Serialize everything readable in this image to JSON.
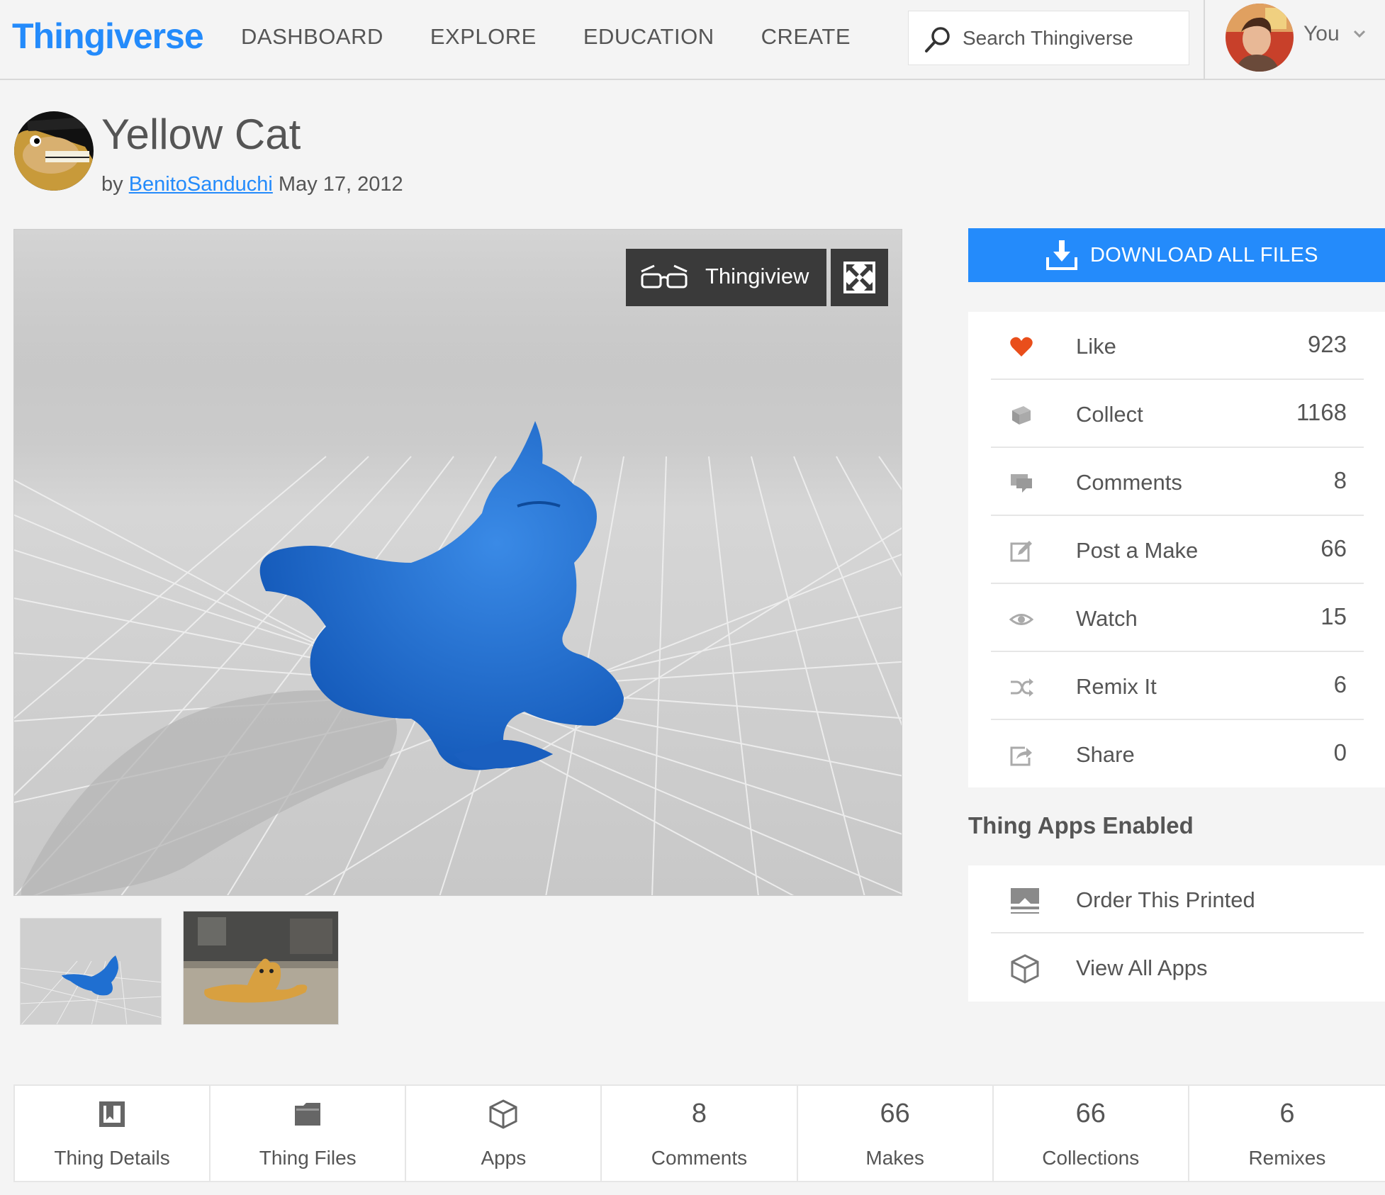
{
  "header": {
    "logo": "Thingiverse",
    "nav": [
      "DASHBOARD",
      "EXPLORE",
      "EDUCATION",
      "CREATE"
    ],
    "search_placeholder": "Search Thingiverse",
    "user_label": "You"
  },
  "thing": {
    "title": "Yellow Cat",
    "by_prefix": "by",
    "author": "BenitoSanduchi",
    "date": "May 17, 2012"
  },
  "viewer": {
    "thingiview_label": "Thingiview",
    "model_color": "#1f6fd1",
    "print_color": "#d8a040"
  },
  "download": {
    "label": "DOWNLOAD ALL FILES"
  },
  "actions": [
    {
      "label": "Like",
      "count": "923",
      "icon": "heart-icon"
    },
    {
      "label": "Collect",
      "count": "1168",
      "icon": "collect-icon"
    },
    {
      "label": "Comments",
      "count": "8",
      "icon": "comment-icon"
    },
    {
      "label": "Post a Make",
      "count": "66",
      "icon": "edit-icon"
    },
    {
      "label": "Watch",
      "count": "15",
      "icon": "eye-icon"
    },
    {
      "label": "Remix It",
      "count": "6",
      "icon": "shuffle-icon"
    },
    {
      "label": "Share",
      "count": "0",
      "icon": "share-icon"
    }
  ],
  "apps": {
    "heading": "Thing Apps Enabled",
    "items": [
      {
        "label": "Order This Printed",
        "icon": "printer-icon"
      },
      {
        "label": "View All Apps",
        "icon": "cube-icon"
      }
    ]
  },
  "tabs": [
    {
      "label": "Thing Details",
      "icon": "details-icon"
    },
    {
      "label": "Thing Files",
      "icon": "folder-icon"
    },
    {
      "label": "Apps",
      "icon": "cube-icon"
    },
    {
      "label": "Comments",
      "count": "8"
    },
    {
      "label": "Makes",
      "count": "66"
    },
    {
      "label": "Collections",
      "count": "66"
    },
    {
      "label": "Remixes",
      "count": "6"
    }
  ],
  "colors": {
    "brand_blue": "#248bfb",
    "like_red": "#e94e1b"
  }
}
